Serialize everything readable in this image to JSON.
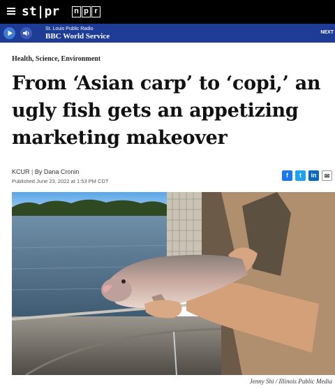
{
  "nav": {
    "brand": "st|pr",
    "partner_letters": [
      "n",
      "p",
      "r"
    ]
  },
  "player": {
    "station": "St. Louis Public Radio",
    "program": "BBC World Service",
    "next": "NEXT"
  },
  "article": {
    "category": "Health, Science, Environment",
    "headline": "From ‘Asian carp’ to ‘copi,’ an ugly fish gets an appetizing marketing makeover",
    "source": "KCUR",
    "author": "By Dana Cronin",
    "published": "Published June 23, 2022 at 1:53 PM CDT",
    "share": {
      "facebook": "f",
      "twitter": "t",
      "linkedin": "in",
      "email": "✉"
    },
    "photo_credit": "Jenny Shi  /  Illinois Public Media"
  },
  "colors": {
    "top_bar": "#000000",
    "radio_bar": "#1e3c96",
    "facebook": "#1877f2",
    "twitter": "#1da1f2",
    "linkedin": "#0a66c2"
  }
}
